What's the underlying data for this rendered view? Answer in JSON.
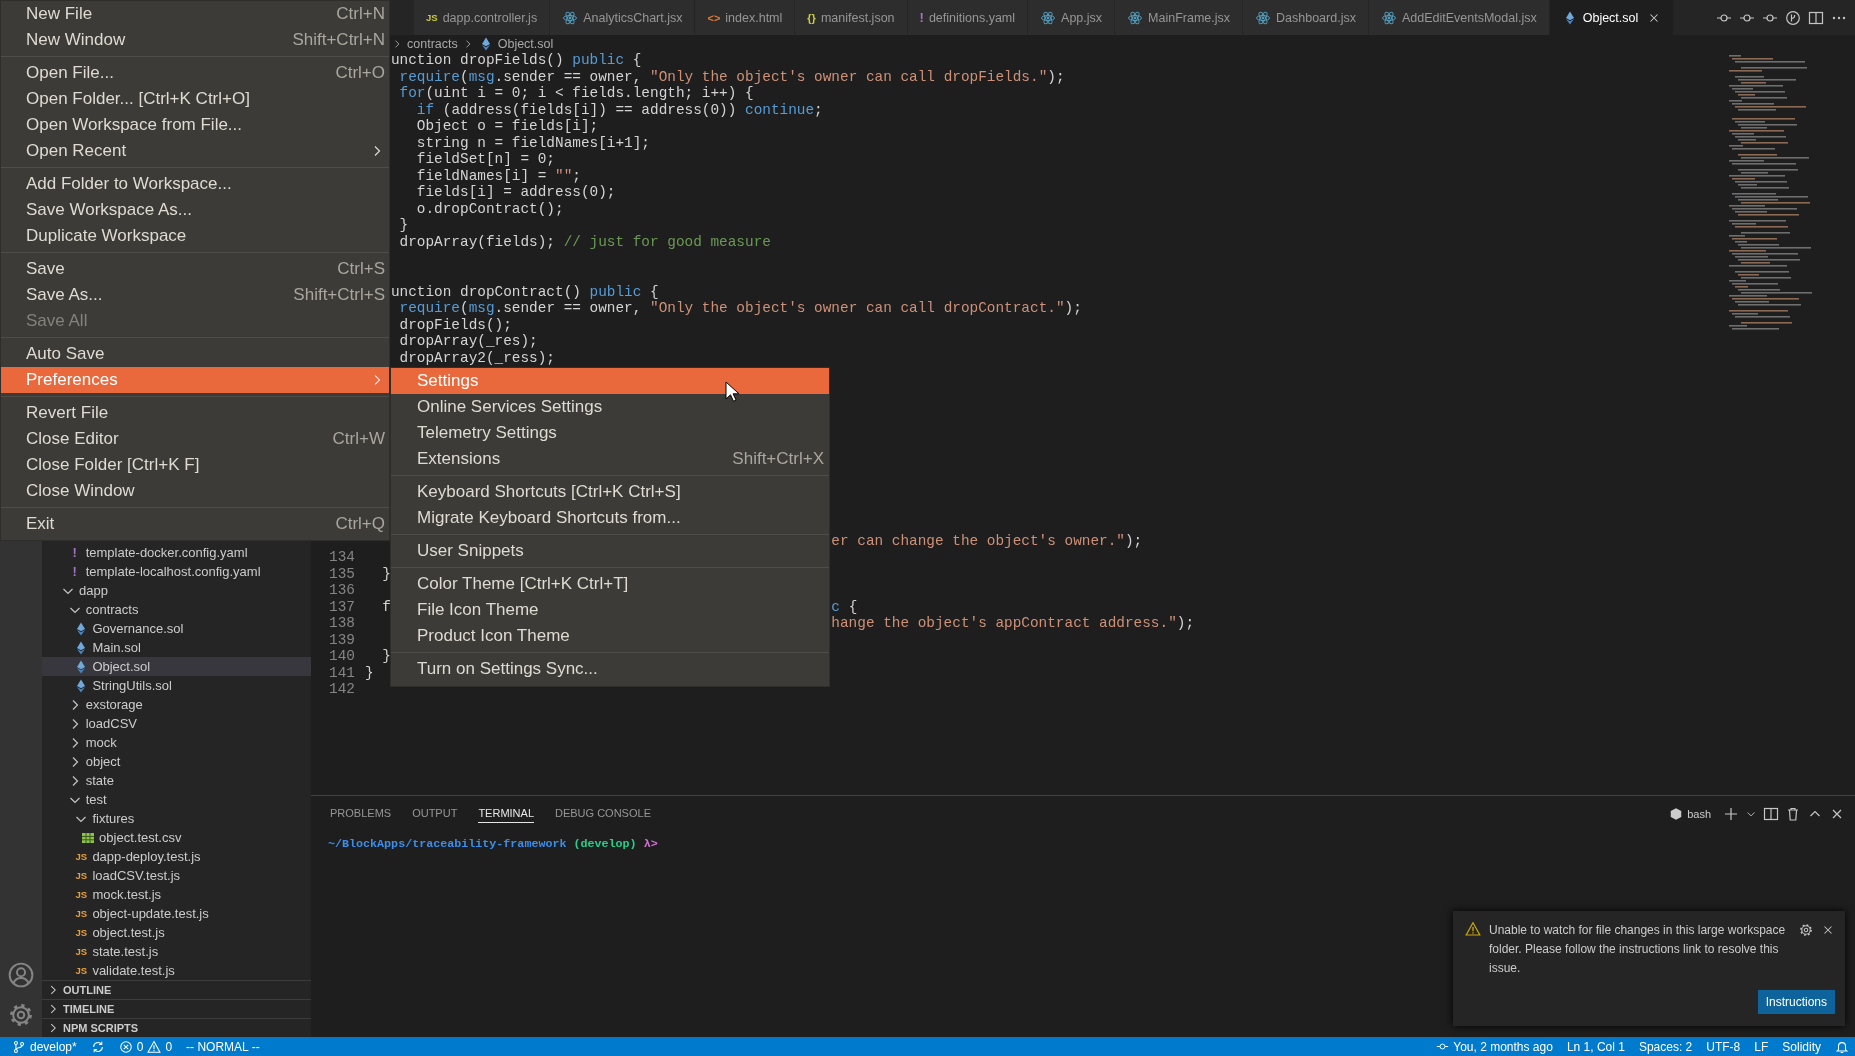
{
  "file_menu": {
    "items": [
      {
        "kind": "item",
        "label": "New File",
        "shortcut": "Ctrl+N",
        "arrow": false,
        "disabled": false,
        "selected": false
      },
      {
        "kind": "item",
        "label": "New Window",
        "shortcut": "Shift+Ctrl+N",
        "arrow": false,
        "disabled": false,
        "selected": false
      },
      {
        "kind": "separator"
      },
      {
        "kind": "item",
        "label": "Open File...",
        "shortcut": "Ctrl+O",
        "arrow": false,
        "disabled": false,
        "selected": false
      },
      {
        "kind": "item",
        "label": "Open Folder... [Ctrl+K Ctrl+O]",
        "arrow": false,
        "disabled": false,
        "selected": false
      },
      {
        "kind": "item",
        "label": "Open Workspace from File...",
        "arrow": false,
        "disabled": false,
        "selected": false
      },
      {
        "kind": "item",
        "label": "Open Recent",
        "arrow": true,
        "disabled": false,
        "selected": false
      },
      {
        "kind": "separator"
      },
      {
        "kind": "item",
        "label": "Add Folder to Workspace...",
        "arrow": false,
        "disabled": false,
        "selected": false
      },
      {
        "kind": "item",
        "label": "Save Workspace As...",
        "arrow": false,
        "disabled": false,
        "selected": false
      },
      {
        "kind": "item",
        "label": "Duplicate Workspace",
        "arrow": false,
        "disabled": false,
        "selected": false
      },
      {
        "kind": "separator"
      },
      {
        "kind": "item",
        "label": "Save",
        "shortcut": "Ctrl+S",
        "arrow": false,
        "disabled": false,
        "selected": false
      },
      {
        "kind": "item",
        "label": "Save As...",
        "shortcut": "Shift+Ctrl+S",
        "arrow": false,
        "disabled": false,
        "selected": false
      },
      {
        "kind": "item",
        "label": "Save All",
        "arrow": false,
        "disabled": true,
        "selected": false
      },
      {
        "kind": "separator"
      },
      {
        "kind": "item",
        "label": "Auto Save",
        "arrow": false,
        "disabled": false,
        "selected": false
      },
      {
        "kind": "item",
        "label": "Preferences",
        "arrow": true,
        "disabled": false,
        "selected": true,
        "submenu": {
          "items": [
            {
              "kind": "item",
              "label": "Settings",
              "arrow": false,
              "disabled": false,
              "selected": true
            },
            {
              "kind": "item",
              "label": "Online Services Settings",
              "arrow": false,
              "disabled": false,
              "selected": false
            },
            {
              "kind": "item",
              "label": "Telemetry Settings",
              "arrow": false,
              "disabled": false,
              "selected": false
            },
            {
              "kind": "item",
              "label": "Extensions",
              "shortcut": "Shift+Ctrl+X",
              "arrow": false,
              "disabled": false,
              "selected": false
            },
            {
              "kind": "separator"
            },
            {
              "kind": "item",
              "label": "Keyboard Shortcuts [Ctrl+K Ctrl+S]",
              "arrow": false,
              "disabled": false,
              "selected": false
            },
            {
              "kind": "item",
              "label": "Migrate Keyboard Shortcuts from...",
              "arrow": false,
              "disabled": false,
              "selected": false
            },
            {
              "kind": "separator"
            },
            {
              "kind": "item",
              "label": "User Snippets",
              "arrow": false,
              "disabled": false,
              "selected": false
            },
            {
              "kind": "separator"
            },
            {
              "kind": "item",
              "label": "Color Theme [Ctrl+K Ctrl+T]",
              "arrow": false,
              "disabled": false,
              "selected": false
            },
            {
              "kind": "item",
              "label": "File Icon Theme",
              "arrow": false,
              "disabled": false,
              "selected": false
            },
            {
              "kind": "item",
              "label": "Product Icon Theme",
              "arrow": false,
              "disabled": false,
              "selected": false
            },
            {
              "kind": "separator"
            },
            {
              "kind": "item",
              "label": "Turn on Settings Sync...",
              "arrow": false,
              "disabled": false,
              "selected": false
            }
          ]
        }
      },
      {
        "kind": "separator"
      },
      {
        "kind": "item",
        "label": "Revert File",
        "arrow": false,
        "disabled": false,
        "selected": false
      },
      {
        "kind": "item",
        "label": "Close Editor",
        "shortcut": "Ctrl+W",
        "arrow": false,
        "disabled": false,
        "selected": false
      },
      {
        "kind": "item",
        "label": "Close Folder [Ctrl+K F]",
        "arrow": false,
        "disabled": false,
        "selected": false
      },
      {
        "kind": "item",
        "label": "Close Window",
        "arrow": false,
        "disabled": false,
        "selected": false
      },
      {
        "kind": "separator"
      },
      {
        "kind": "item",
        "label": "Exit",
        "shortcut": "Ctrl+Q",
        "arrow": false,
        "disabled": false,
        "selected": false
      }
    ]
  },
  "explorer": {
    "tree": [
      {
        "kind": "folder",
        "children": [
          {
            "kind": "yaml",
            "name": "template-docker.config.yaml",
            "icon_label": "!",
            "selected": false
          },
          {
            "kind": "yaml",
            "name": "template-localhost.config.yaml",
            "icon_label": "!",
            "selected": false
          }
        ]
      },
      {
        "kind": "folder",
        "name": "dapp",
        "expanded": true,
        "selected": false,
        "children": [
          {
            "kind": "folder",
            "name": "contracts",
            "expanded": true,
            "selected": false,
            "children": [
              {
                "kind": "sol",
                "name": "Governance.sol",
                "selected": false
              },
              {
                "kind": "sol",
                "name": "Main.sol",
                "selected": false
              },
              {
                "kind": "sol",
                "name": "Object.sol",
                "selected": true
              },
              {
                "kind": "sol",
                "name": "StringUtils.sol",
                "selected": false
              }
            ]
          },
          {
            "kind": "folder",
            "name": "exstorage",
            "expanded": false,
            "selected": false
          },
          {
            "kind": "folder",
            "name": "loadCSV",
            "expanded": false,
            "selected": false
          },
          {
            "kind": "folder",
            "name": "mock",
            "expanded": false,
            "selected": false
          },
          {
            "kind": "folder",
            "name": "object",
            "expanded": false,
            "selected": false
          },
          {
            "kind": "folder",
            "name": "state",
            "expanded": false,
            "selected": false
          },
          {
            "kind": "folder",
            "name": "test",
            "expanded": true,
            "selected": false,
            "children": [
              {
                "kind": "folder",
                "name": "fixtures",
                "expanded": true,
                "selected": false,
                "children": [
                  {
                    "kind": "csv",
                    "name": "object.test.csv",
                    "selected": false
                  }
                ]
              },
              {
                "kind": "js",
                "name": "dapp-deploy.test.js",
                "icon_label": "JS",
                "selected": false
              },
              {
                "kind": "js",
                "name": "loadCSV.test.js",
                "icon_label": "JS",
                "selected": false
              },
              {
                "kind": "js",
                "name": "mock.test.js",
                "icon_label": "JS",
                "selected": false
              },
              {
                "kind": "js",
                "name": "object-update.test.js",
                "icon_label": "JS",
                "selected": false
              },
              {
                "kind": "js",
                "name": "object.test.js",
                "icon_label": "JS",
                "selected": false
              },
              {
                "kind": "js",
                "name": "state.test.js",
                "icon_label": "JS",
                "selected": false
              },
              {
                "kind": "js",
                "name": "validate.test.js",
                "icon_label": "JS",
                "selected": false
              }
            ]
          }
        ]
      }
    ],
    "sections": [
      {
        "label": "OUTLINE",
        "expanded": false
      },
      {
        "label": "TIMELINE",
        "expanded": false
      },
      {
        "label": "NPM SCRIPTS",
        "expanded": false
      }
    ]
  },
  "editor": {
    "tabs": [
      {
        "label": "dapp.controller.js",
        "kind": "js",
        "icon_label": "JS",
        "selected": false
      },
      {
        "label": "AnalyticsChart.jsx",
        "kind": "react",
        "selected": false
      },
      {
        "label": "index.html",
        "kind": "html",
        "icon_label": "<>",
        "selected": false
      },
      {
        "label": "manifest.json",
        "kind": "json",
        "icon_label": "{}",
        "selected": false
      },
      {
        "label": "definitions.yaml",
        "kind": "yaml",
        "icon_label": "!",
        "selected": false
      },
      {
        "label": "App.jsx",
        "kind": "react",
        "selected": false
      },
      {
        "label": "MainFrame.jsx",
        "kind": "react",
        "selected": false
      },
      {
        "label": "Dashboard.jsx",
        "kind": "react",
        "selected": false
      },
      {
        "label": "AddEditEventsModal.jsx",
        "kind": "react",
        "selected": false
      },
      {
        "label": "Object.sol",
        "kind": "sol",
        "selected": true
      }
    ],
    "breadcrumb": [
      {
        "label": "contracts",
        "kind": "folder"
      },
      {
        "label": "Object.sol",
        "kind": "sol"
      }
    ],
    "blocks": [
      {
        "lines": [
          {
            "parts": [
              [
                {
                  "kind": "plain",
                  "text": "   unction dropFields() "
                },
                {
                  "kind": "keyword",
                  "text": "public"
                },
                {
                  "kind": "plain",
                  "text": " {"
                }
              ]
            ]
          },
          {
            "parts": [
              [
                {
                  "kind": "keyword",
                  "text": "    require"
                },
                {
                  "kind": "plain",
                  "text": "("
                },
                {
                  "kind": "keyword",
                  "text": "msg"
                },
                {
                  "kind": "plain",
                  "text": ".sender == owner, "
                },
                {
                  "kind": "string",
                  "text": "\"Only the object's owner can call dropFields.\""
                },
                {
                  "kind": "plain",
                  "text": ");"
                }
              ]
            ]
          },
          {
            "parts": [
              [
                {
                  "kind": "keyword",
                  "text": "    for"
                },
                {
                  "kind": "plain",
                  "text": "(uint i = 0; i < fields.length; i++) {"
                }
              ]
            ]
          },
          {
            "parts": [
              [
                {
                  "kind": "keyword",
                  "text": "      if"
                },
                {
                  "kind": "plain",
                  "text": " (address(fields[i]) == address(0)) "
                },
                {
                  "kind": "keyword",
                  "text": "continue"
                },
                {
                  "kind": "plain",
                  "text": ";"
                }
              ]
            ]
          },
          {
            "parts": [
              [
                {
                  "kind": "plain",
                  "text": "      Object o = fields[i];"
                }
              ]
            ]
          },
          {
            "parts": [
              [
                {
                  "kind": "plain",
                  "text": "      string n = fieldNames[i+1];"
                }
              ]
            ]
          },
          {
            "parts": [
              [
                {
                  "kind": "plain",
                  "text": "      fieldSet[n] = 0;"
                }
              ]
            ]
          },
          {
            "parts": [
              [
                {
                  "kind": "plain",
                  "text": "      fieldNames[i] = "
                },
                {
                  "kind": "string",
                  "text": "\"\""
                },
                {
                  "kind": "plain",
                  "text": ";"
                }
              ]
            ]
          },
          {
            "parts": [
              [
                {
                  "kind": "plain",
                  "text": "      fields[i] = address(0);"
                }
              ]
            ]
          },
          {
            "parts": [
              [
                {
                  "kind": "plain",
                  "text": "      o.dropContract();"
                }
              ]
            ]
          },
          {
            "parts": [
              [
                {
                  "kind": "plain",
                  "text": "    }"
                }
              ]
            ]
          },
          {
            "parts": [
              [
                {
                  "kind": "plain",
                  "text": "    dropArray(fields); "
                },
                {
                  "kind": "comment",
                  "text": "// just for good measure"
                }
              ]
            ]
          }
        ]
      },
      {
        "lines": [
          {
            "parts": [
              [
                {
                  "kind": "plain",
                  "text": "   unction dropContract() "
                },
                {
                  "kind": "keyword",
                  "text": "public"
                },
                {
                  "kind": "plain",
                  "text": " {"
                }
              ]
            ]
          },
          {
            "parts": [
              [
                {
                  "kind": "keyword",
                  "text": "    require"
                },
                {
                  "kind": "plain",
                  "text": "("
                },
                {
                  "kind": "keyword",
                  "text": "msg"
                },
                {
                  "kind": "plain",
                  "text": ".sender == owner, "
                },
                {
                  "kind": "string",
                  "text": "\"Only the object's owner can call dropContract.\""
                },
                {
                  "kind": "plain",
                  "text": ");"
                }
              ]
            ]
          },
          {
            "parts": [
              [
                {
                  "kind": "plain",
                  "text": "    dropFields();"
                }
              ]
            ]
          },
          {
            "parts": [
              [
                {
                  "kind": "plain",
                  "text": "    dropArray(_res);"
                }
              ]
            ]
          },
          {
            "parts": [
              [
                {
                  "kind": "plain",
                  "text": "    dropArray2(_ress);"
                }
              ]
            ]
          }
        ]
      },
      {
        "lines": [
          {
            "parts": [
              [
                {
                  "kind": "string",
                  "text": "                                                      er can change the object's owner.\""
                },
                {
                  "kind": "plain",
                  "text": ");"
                }
              ]
            ]
          },
          {
            "number": "134"
          },
          {
            "number": "135",
            "parts": [
              [
                {
                  "kind": "plain",
                  "text": "  }"
                }
              ]
            ]
          },
          {
            "number": "136"
          },
          {
            "number": "137",
            "parts": [
              [
                {
                  "kind": "plain",
                  "text": "  f"
                }
              ],
              [
                {
                  "kind": "keyword",
                  "text": "                                                   c"
                },
                {
                  "kind": "plain",
                  "text": " {"
                }
              ]
            ]
          },
          {
            "number": "138",
            "parts": [
              [
                {
                  "kind": "string",
                  "text": "                                                      hange the object's appContract address.\""
                },
                {
                  "kind": "plain",
                  "text": ");"
                }
              ]
            ]
          },
          {
            "number": "139"
          },
          {
            "number": "140",
            "parts": [
              [
                {
                  "kind": "plain",
                  "text": "  }"
                }
              ]
            ]
          },
          {
            "number": "141",
            "parts": [
              [
                {
                  "kind": "plain",
                  "text": "}"
                }
              ]
            ]
          },
          {
            "number": "142"
          }
        ]
      }
    ]
  },
  "panel": {
    "tabs": [
      {
        "label": "PROBLEMS",
        "selected": false
      },
      {
        "label": "OUTPUT",
        "selected": false
      },
      {
        "label": "TERMINAL",
        "selected": true
      },
      {
        "label": "DEBUG CONSOLE",
        "selected": false
      }
    ],
    "shell": "bash",
    "prompt": [
      {
        "kind": "path",
        "text": "~/BlockApps/traceability-framework"
      },
      {
        "kind": "branch",
        "text": "(develop)"
      },
      {
        "kind": "symbol",
        "text": "λ>"
      }
    ]
  },
  "notification": {
    "message": "Unable to watch for file changes in this large workspace folder. Please follow the instructions link to resolve this issue.",
    "button": "Instructions"
  },
  "status_bar": {
    "left": [
      {
        "kind": "branch",
        "text": "develop*"
      },
      {
        "kind": "sync"
      },
      {
        "kind": "problems",
        "errors": "0",
        "warnings": "0"
      },
      {
        "kind": "text",
        "text": "-- NORMAL --"
      }
    ],
    "right": [
      {
        "kind": "blame",
        "text": "You, 2 months ago"
      },
      {
        "kind": "text",
        "text": "Ln 1, Col 1"
      },
      {
        "kind": "text",
        "text": "Spaces: 2"
      },
      {
        "kind": "text",
        "text": "UTF-8"
      },
      {
        "kind": "text",
        "text": "LF"
      },
      {
        "kind": "text",
        "text": "Solidity"
      },
      {
        "kind": "bell"
      }
    ]
  }
}
